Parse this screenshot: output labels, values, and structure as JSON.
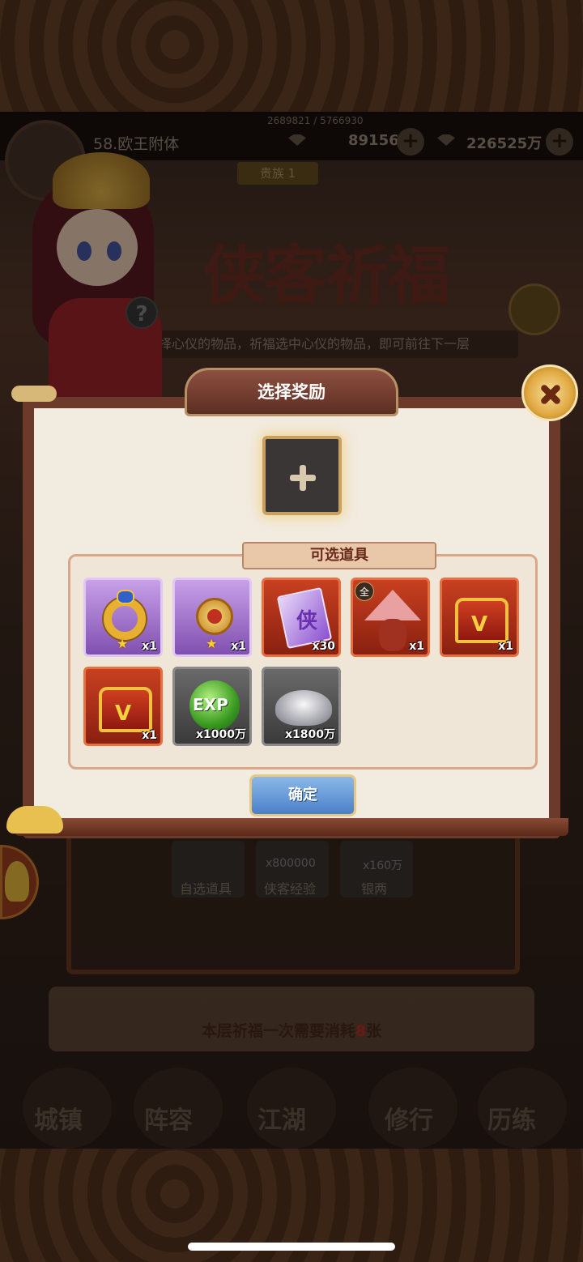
{
  "status": {
    "exp": "2689821 / 5766930",
    "player_name": "58.欧王附体",
    "gold": "89156",
    "silver": "226525万",
    "vip": "贵族 1"
  },
  "banner": {
    "title": "侠客祈福",
    "subtitle": "选择心仪的物品，祈福选中心仪的物品，即可前往下一层",
    "help": "?"
  },
  "dialog": {
    "title": "选择奖励",
    "items_label": "可选道具",
    "confirm_label": "确定",
    "items": [
      {
        "name": "ring",
        "quality": "purple",
        "count": "x1",
        "stars": 1
      },
      {
        "name": "pendant",
        "quality": "purple",
        "count": "x1",
        "stars": 1
      },
      {
        "name": "scroll",
        "quality": "red",
        "count": "x30",
        "glyph": "侠"
      },
      {
        "name": "hero-card",
        "quality": "red",
        "count": "x1",
        "badge": "全"
      },
      {
        "name": "chest",
        "quality": "red",
        "count": "x1"
      },
      {
        "name": "chest",
        "quality": "red",
        "count": "x1"
      },
      {
        "name": "exp-orb",
        "quality": "gray",
        "count": "x1000万",
        "label": "EXP"
      },
      {
        "name": "silver-ingot",
        "quality": "gray",
        "count": "x1800万"
      }
    ]
  },
  "background": {
    "slots": [
      {
        "label": "自选道具",
        "count": ""
      },
      {
        "label": "侠客经验",
        "count": "x800000"
      },
      {
        "label": "银两",
        "count": "x160万"
      }
    ],
    "cost_prefix": "本层祈福一次需要消耗",
    "cost_num": "8",
    "cost_suffix": "张",
    "nav": [
      "城镇",
      "阵容",
      "江湖",
      "修行",
      "历练"
    ]
  }
}
